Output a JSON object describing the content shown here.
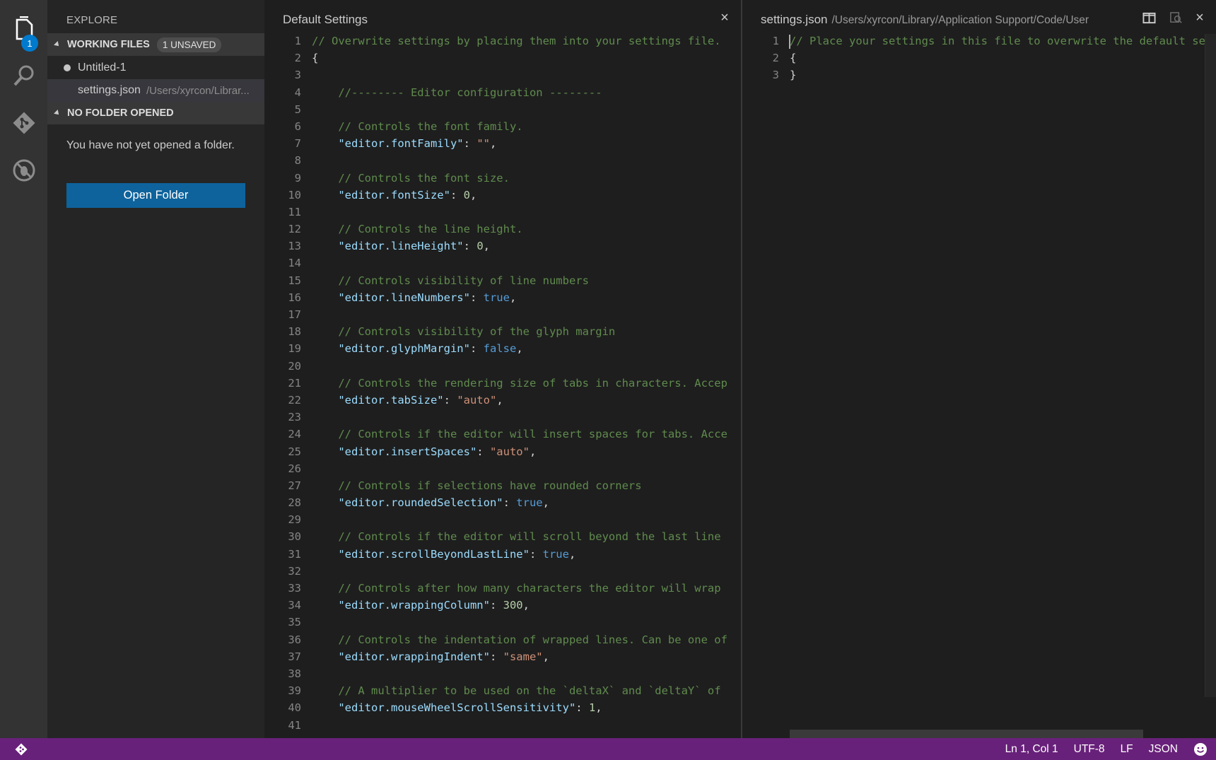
{
  "sidebar": {
    "title": "EXPLORE",
    "working_files": {
      "header": "WORKING FILES",
      "badge": "1 UNSAVED",
      "items": [
        {
          "name": "Untitled-1",
          "path": ""
        },
        {
          "name": "settings.json",
          "path": "/Users/xyrcon/Librar..."
        }
      ]
    },
    "no_folder": {
      "header": "NO FOLDER OPENED",
      "message": "You have not yet opened a folder.",
      "button": "Open Folder"
    }
  },
  "activity": {
    "badge": "1"
  },
  "left_editor": {
    "title": "Default Settings",
    "close": "×",
    "lines": [
      {
        "n": "1",
        "parts": [
          {
            "t": "// Overwrite settings by placing them into your settings file.",
            "c": "c-comment"
          }
        ]
      },
      {
        "n": "2",
        "parts": [
          {
            "t": "{",
            "c": ""
          }
        ]
      },
      {
        "n": "3",
        "parts": []
      },
      {
        "n": "4",
        "parts": [
          {
            "t": "    //-------- Editor configuration --------",
            "c": "c-comment"
          }
        ]
      },
      {
        "n": "5",
        "parts": []
      },
      {
        "n": "6",
        "parts": [
          {
            "t": "    // Controls the font family.",
            "c": "c-comment"
          }
        ]
      },
      {
        "n": "7",
        "parts": [
          {
            "t": "    ",
            "c": ""
          },
          {
            "t": "\"editor.fontFamily\"",
            "c": "c-key"
          },
          {
            "t": ": ",
            "c": ""
          },
          {
            "t": "\"\"",
            "c": "c-str"
          },
          {
            "t": ",",
            "c": ""
          }
        ]
      },
      {
        "n": "8",
        "parts": []
      },
      {
        "n": "9",
        "parts": [
          {
            "t": "    // Controls the font size.",
            "c": "c-comment"
          }
        ]
      },
      {
        "n": "10",
        "parts": [
          {
            "t": "    ",
            "c": ""
          },
          {
            "t": "\"editor.fontSize\"",
            "c": "c-key"
          },
          {
            "t": ": ",
            "c": ""
          },
          {
            "t": "0",
            "c": "c-num"
          },
          {
            "t": ",",
            "c": ""
          }
        ]
      },
      {
        "n": "11",
        "parts": []
      },
      {
        "n": "12",
        "parts": [
          {
            "t": "    // Controls the line height.",
            "c": "c-comment"
          }
        ]
      },
      {
        "n": "13",
        "parts": [
          {
            "t": "    ",
            "c": ""
          },
          {
            "t": "\"editor.lineHeight\"",
            "c": "c-key"
          },
          {
            "t": ": ",
            "c": ""
          },
          {
            "t": "0",
            "c": "c-num"
          },
          {
            "t": ",",
            "c": ""
          }
        ]
      },
      {
        "n": "14",
        "parts": []
      },
      {
        "n": "15",
        "parts": [
          {
            "t": "    // Controls visibility of line numbers",
            "c": "c-comment"
          }
        ]
      },
      {
        "n": "16",
        "parts": [
          {
            "t": "    ",
            "c": ""
          },
          {
            "t": "\"editor.lineNumbers\"",
            "c": "c-key"
          },
          {
            "t": ": ",
            "c": ""
          },
          {
            "t": "true",
            "c": "c-bool"
          },
          {
            "t": ",",
            "c": ""
          }
        ]
      },
      {
        "n": "17",
        "parts": []
      },
      {
        "n": "18",
        "parts": [
          {
            "t": "    // Controls visibility of the glyph margin",
            "c": "c-comment"
          }
        ]
      },
      {
        "n": "19",
        "parts": [
          {
            "t": "    ",
            "c": ""
          },
          {
            "t": "\"editor.glyphMargin\"",
            "c": "c-key"
          },
          {
            "t": ": ",
            "c": ""
          },
          {
            "t": "false",
            "c": "c-bool"
          },
          {
            "t": ",",
            "c": ""
          }
        ]
      },
      {
        "n": "20",
        "parts": []
      },
      {
        "n": "21",
        "parts": [
          {
            "t": "    // Controls the rendering size of tabs in characters. Accep",
            "c": "c-comment"
          }
        ]
      },
      {
        "n": "22",
        "parts": [
          {
            "t": "    ",
            "c": ""
          },
          {
            "t": "\"editor.tabSize\"",
            "c": "c-key"
          },
          {
            "t": ": ",
            "c": ""
          },
          {
            "t": "\"auto\"",
            "c": "c-str"
          },
          {
            "t": ",",
            "c": ""
          }
        ]
      },
      {
        "n": "23",
        "parts": []
      },
      {
        "n": "24",
        "parts": [
          {
            "t": "    // Controls if the editor will insert spaces for tabs. Acce",
            "c": "c-comment"
          }
        ]
      },
      {
        "n": "25",
        "parts": [
          {
            "t": "    ",
            "c": ""
          },
          {
            "t": "\"editor.insertSpaces\"",
            "c": "c-key"
          },
          {
            "t": ": ",
            "c": ""
          },
          {
            "t": "\"auto\"",
            "c": "c-str"
          },
          {
            "t": ",",
            "c": ""
          }
        ]
      },
      {
        "n": "26",
        "parts": []
      },
      {
        "n": "27",
        "parts": [
          {
            "t": "    // Controls if selections have rounded corners",
            "c": "c-comment"
          }
        ]
      },
      {
        "n": "28",
        "parts": [
          {
            "t": "    ",
            "c": ""
          },
          {
            "t": "\"editor.roundedSelection\"",
            "c": "c-key"
          },
          {
            "t": ": ",
            "c": ""
          },
          {
            "t": "true",
            "c": "c-bool"
          },
          {
            "t": ",",
            "c": ""
          }
        ]
      },
      {
        "n": "29",
        "parts": []
      },
      {
        "n": "30",
        "parts": [
          {
            "t": "    // Controls if the editor will scroll beyond the last line",
            "c": "c-comment"
          }
        ]
      },
      {
        "n": "31",
        "parts": [
          {
            "t": "    ",
            "c": ""
          },
          {
            "t": "\"editor.scrollBeyondLastLine\"",
            "c": "c-key"
          },
          {
            "t": ": ",
            "c": ""
          },
          {
            "t": "true",
            "c": "c-bool"
          },
          {
            "t": ",",
            "c": ""
          }
        ]
      },
      {
        "n": "32",
        "parts": []
      },
      {
        "n": "33",
        "parts": [
          {
            "t": "    // Controls after how many characters the editor will wrap",
            "c": "c-comment"
          }
        ]
      },
      {
        "n": "34",
        "parts": [
          {
            "t": "    ",
            "c": ""
          },
          {
            "t": "\"editor.wrappingColumn\"",
            "c": "c-key"
          },
          {
            "t": ": ",
            "c": ""
          },
          {
            "t": "300",
            "c": "c-num"
          },
          {
            "t": ",",
            "c": ""
          }
        ]
      },
      {
        "n": "35",
        "parts": []
      },
      {
        "n": "36",
        "parts": [
          {
            "t": "    // Controls the indentation of wrapped lines. Can be one of",
            "c": "c-comment"
          }
        ]
      },
      {
        "n": "37",
        "parts": [
          {
            "t": "    ",
            "c": ""
          },
          {
            "t": "\"editor.wrappingIndent\"",
            "c": "c-key"
          },
          {
            "t": ": ",
            "c": ""
          },
          {
            "t": "\"same\"",
            "c": "c-str"
          },
          {
            "t": ",",
            "c": ""
          }
        ]
      },
      {
        "n": "38",
        "parts": []
      },
      {
        "n": "39",
        "parts": [
          {
            "t": "    // A multiplier to be used on the `deltaX` and `deltaY` of",
            "c": "c-comment"
          }
        ]
      },
      {
        "n": "40",
        "parts": [
          {
            "t": "    ",
            "c": ""
          },
          {
            "t": "\"editor.mouseWheelScrollSensitivity\"",
            "c": "c-key"
          },
          {
            "t": ": ",
            "c": ""
          },
          {
            "t": "1",
            "c": "c-num"
          },
          {
            "t": ",",
            "c": ""
          }
        ]
      },
      {
        "n": "41",
        "parts": []
      }
    ]
  },
  "right_editor": {
    "title": "settings.json",
    "path": "/Users/xyrcon/Library/Application Support/Code/User",
    "close": "×",
    "lines": [
      {
        "n": "1",
        "parts": [
          {
            "t": "// Place your settings in this file to overwrite the default se",
            "c": "c-comment"
          }
        ]
      },
      {
        "n": "2",
        "parts": [
          {
            "t": "{",
            "c": ""
          }
        ]
      },
      {
        "n": "3",
        "parts": [
          {
            "t": "}",
            "c": ""
          }
        ]
      }
    ]
  },
  "status": {
    "position": "Ln 1, Col 1",
    "encoding": "UTF-8",
    "eol": "LF",
    "language": "JSON"
  }
}
